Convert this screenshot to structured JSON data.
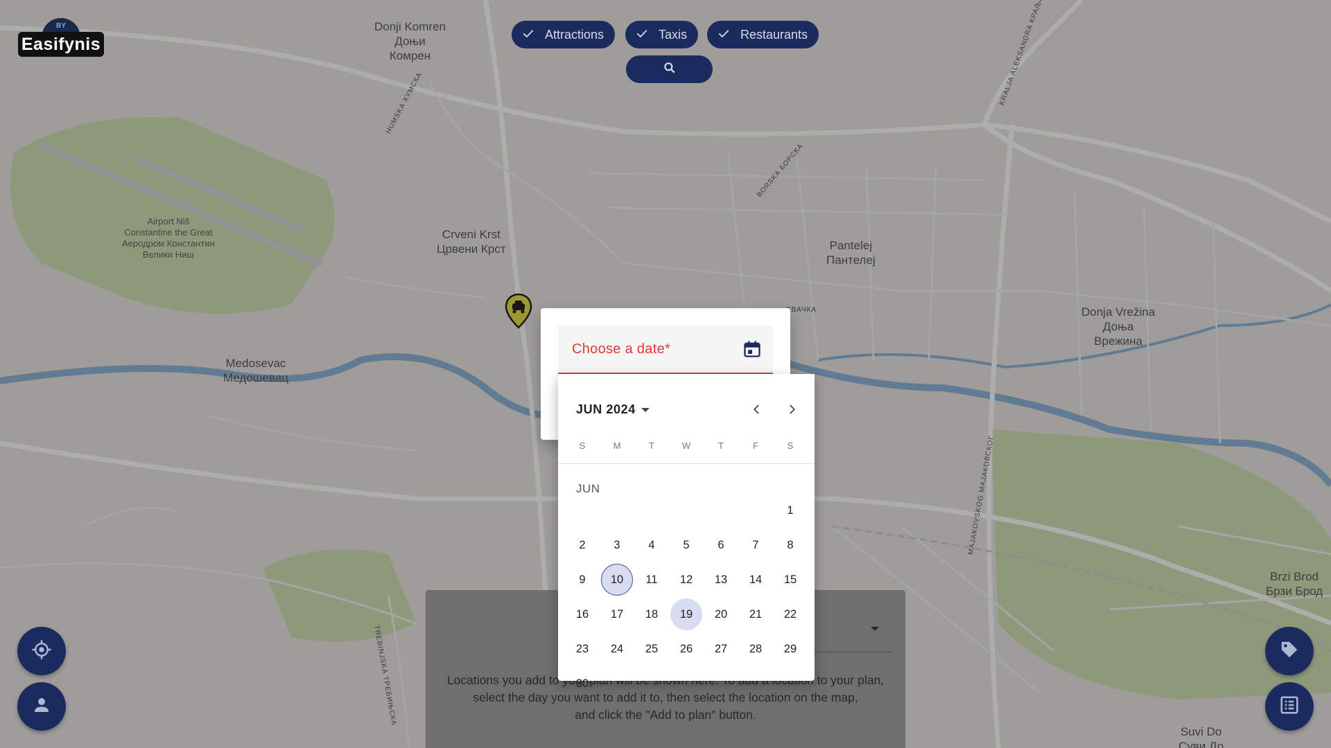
{
  "logo": {
    "text": "Easifynis",
    "badge": "BY"
  },
  "filters": [
    {
      "label": "Attractions",
      "checked": true,
      "icon": "check-icon"
    },
    {
      "label": "Taxis",
      "checked": true,
      "icon": "check-icon"
    },
    {
      "label": "Restaurants",
      "checked": true,
      "icon": "check-icon"
    }
  ],
  "search": {
    "icon": "search-icon"
  },
  "map": {
    "places": [
      {
        "name": "Donji Komren\nДоњи\nКомрен"
      },
      {
        "name": "Crveni Krst\nЦрвени Крст"
      },
      {
        "name": "Pantelej\nПантелеј"
      },
      {
        "name": "Donja Vrežina\nДоња\nВрежина"
      },
      {
        "name": "Medosevac\nМедошевац"
      },
      {
        "name": "Brzi Brod\nБрзи Брод"
      },
      {
        "name": "Suvi Do\nСуви До"
      },
      {
        "name": "Airport Niš\nConstantine the Great\nАеродром Константин\nВелики Ниш"
      }
    ],
    "roads": [
      {
        "name": "HUMSKA ХУМСКА"
      },
      {
        "name": "BORSKA БОРСКА"
      },
      {
        "name": "KRALJA ALEKSANDRA КРАЉА АЛ"
      },
      {
        "name": "MAJAKOVSKOG МАЈАКОВСКОГ"
      },
      {
        "name": "TREBINJSKA ТРЕБИЊСКА"
      },
      {
        "name": "ЕВАЧКА"
      }
    ],
    "marker": {
      "icon": "taxi-marker-icon"
    }
  },
  "date_dialog": {
    "field_label": "Choose a date*",
    "toggle_icon": "calendar-icon"
  },
  "calendar": {
    "period_label": "JUN 2024",
    "month_label": "JUN",
    "weekdays": [
      "S",
      "M",
      "T",
      "W",
      "T",
      "F",
      "S"
    ],
    "first_weekday_index": 6,
    "days_in_month": 30,
    "today": 10,
    "selected": 19,
    "prev_icon": "chevron-left-icon",
    "next_icon": "chevron-right-icon"
  },
  "plan_panel": {
    "empty_text": "Locations you add to your plan will be shown here. To add a location to your plan,\nselect the day you want to add it to, then select the location on the map,\nand click the \"Add to plan\" button."
  },
  "fabs": {
    "locate_icon": "crosshair-icon",
    "profile_icon": "person-icon",
    "tag_icon": "tag-icon",
    "list_icon": "list-icon"
  }
}
